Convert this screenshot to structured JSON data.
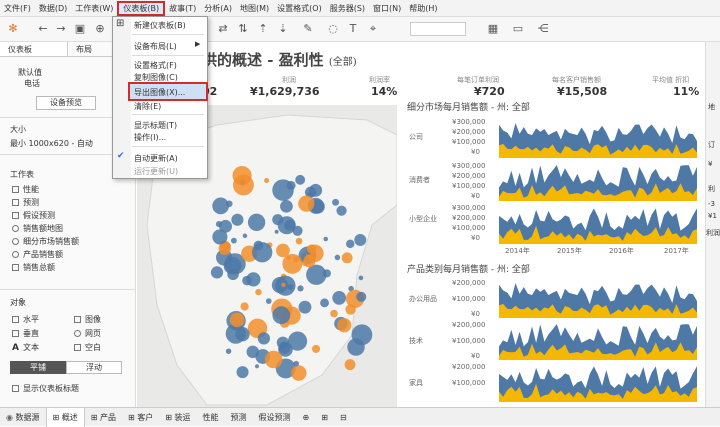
{
  "menubar": {
    "items": [
      "文件(F)",
      "数据(D)",
      "工作表(W)",
      "仪表板(B)",
      "故事(T)",
      "分析(A)",
      "地图(M)",
      "设置格式(O)",
      "服务器(S)",
      "窗口(N)",
      "帮助(H)"
    ],
    "active_index": 3
  },
  "dropdown": {
    "new_dashboard": "新建仪表板(B)",
    "layout": "设备布局(L)",
    "format": "设置格式(F)",
    "copy_image": "复制图像(C)",
    "export_image": "导出图像(X)...",
    "clear": "清除(E)",
    "show_title": "显示标题(T)",
    "actions": "操作(I)...",
    "auto_update": "自动更新(A)",
    "run_update": "运行更新(U)"
  },
  "sidebar": {
    "tabs": [
      "仪表板",
      "布局"
    ],
    "default_label": "默认值",
    "phone_label": "电话",
    "device_preview": "设备预览",
    "size_title": "大小",
    "size_value": "最小 1000x620 - 自动",
    "sheets_title": "工作表",
    "sheets": [
      "性能",
      "预测",
      "假设预测",
      "销售额地图",
      "细分市场销售额",
      "产品销售额",
      "销售总额"
    ],
    "objects_title": "对象",
    "objects": [
      "水平",
      "图像",
      "垂直",
      "网页",
      "文本",
      "空白"
    ],
    "tiled": "平铺",
    "floating": "浮动",
    "show_title_checkbox": "显示仪表板标题"
  },
  "dashboard": {
    "title": "供的概述 - 盈利性",
    "title_suffix": "(全部)",
    "kpis": [
      {
        "label": "利润",
        "value": "¥1,629,736"
      },
      {
        "label": "利润率",
        "value": "14%"
      },
      {
        "label": "每笔订单利润",
        "value": "¥720"
      },
      {
        "label": "每名客户销售额",
        "value": "¥15,508"
      },
      {
        "label": "平均值 折扣",
        "value": "11%"
      }
    ],
    "first_kpi_partial": "02",
    "segment_title": "细分市场每月销售额 - 州: 全部",
    "segment_rows": [
      "公司",
      "消费者",
      "小型企业"
    ],
    "segment_ticks": [
      "¥300,000",
      "¥200,000",
      "¥100,000",
      "¥0"
    ],
    "years": [
      "2014年",
      "2015年",
      "2016年",
      "2017年"
    ],
    "category_title": "产品类别每月销售额 - 州: 全部",
    "category_rows": [
      "办公用品",
      "技术",
      "家具"
    ],
    "category_ticks": [
      "¥200,000",
      "¥100,000",
      "¥0"
    ]
  },
  "right_panel": {
    "labels": [
      "地",
      "订",
      "¥",
      "利",
      "-3",
      "¥1",
      "利润"
    ]
  },
  "statusbar": {
    "datasource": "数据源",
    "tabs": [
      "概述",
      "产品",
      "客户",
      "装运",
      "性能",
      "预测",
      "假设预测"
    ]
  },
  "colors": {
    "blue": "#4e79a7",
    "orange": "#f28e2b",
    "gold": "#f5b800",
    "red": "#d32b2b"
  }
}
